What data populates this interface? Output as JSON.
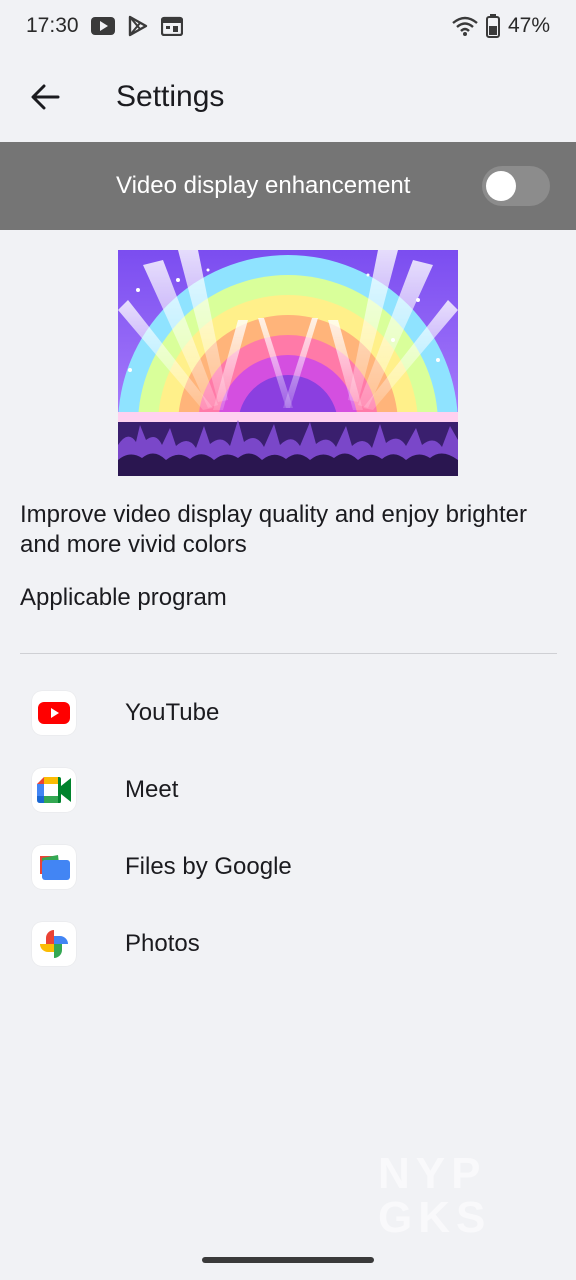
{
  "status_bar": {
    "time": "17:30",
    "notification_icons": [
      "youtube-icon",
      "play-store-icon",
      "calendar-icon"
    ],
    "wifi_icon": "wifi-icon",
    "battery_icon": "battery-icon",
    "battery_percent": "47%"
  },
  "app_bar": {
    "back_icon": "arrow-back-icon",
    "title": "Settings"
  },
  "toggle": {
    "label": "Video display enhancement",
    "enabled": false
  },
  "hero": {
    "icon": "concert-illustration"
  },
  "description": "Improve video display quality and enjoy brighter and more vivid colors",
  "section_label": "Applicable program",
  "apps": [
    {
      "name": "YouTube",
      "icon": "youtube-app-icon"
    },
    {
      "name": "Meet",
      "icon": "meet-app-icon"
    },
    {
      "name": "Files by Google",
      "icon": "files-app-icon"
    },
    {
      "name": "Photos",
      "icon": "photos-app-icon"
    }
  ],
  "watermark": "NYP GKS"
}
